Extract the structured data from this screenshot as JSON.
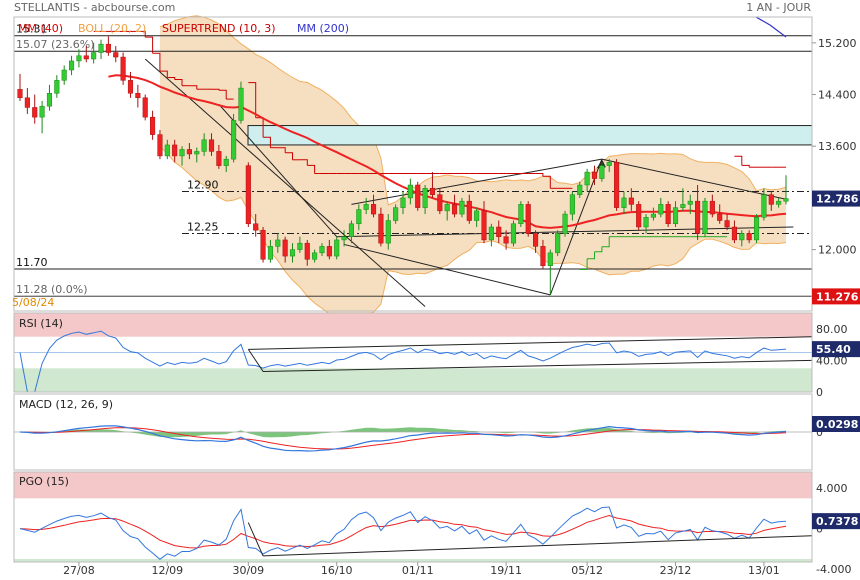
{
  "header": {
    "title": "STELLANTIS - abcbourse.com",
    "period": "1 AN - JOUR"
  },
  "colors": {
    "up": "#33cc33",
    "down": "#ee2222",
    "mm40": "#ee2222",
    "mm200": "#3333cc",
    "boll_fill": "#f5d9b5",
    "boll_line": "#f0b060",
    "supertrend": "#cc0000",
    "supertrend_up": "#22aa22",
    "zone_fill": "#cfeeee",
    "overbought": "#f4c8c8",
    "oversold": "#cfe8cf",
    "rsi": "#3377dd",
    "macd": "#3377dd",
    "signal": "#ee2222",
    "hist": "#66bb66",
    "pgo": "#3377dd",
    "pgo_signal": "#ee2222",
    "badge": "#1e2a6a",
    "badge_red": "#dd1111"
  },
  "legend_price": [
    {
      "label": "MM (40)",
      "color": "#dd0000"
    },
    {
      "label": "BOLL (20, 2)",
      "color": "#f0a040"
    },
    {
      "label": "SUPERTREND (10, 3)",
      "color": "#cc0000"
    },
    {
      "label": "MM (200)",
      "color": "#3333cc"
    }
  ],
  "legend_rsi": "RSI (14)",
  "legend_macd": "MACD (12, 26, 9)",
  "legend_pgo": "PGO (15)",
  "price_levels": [
    {
      "price": 15.31,
      "label": "15.31"
    },
    {
      "price": 15.07,
      "label": "15.07  (23.6%)"
    },
    {
      "price": 11.7,
      "label": "11.70"
    },
    {
      "price": 11.28,
      "label": "11.28  (0.0%)"
    }
  ],
  "dash_levels": [
    {
      "price": 12.9,
      "label": "12.90"
    },
    {
      "price": 12.25,
      "label": "12.25"
    }
  ],
  "zone": {
    "from": 13.62,
    "to": 13.92
  },
  "date_marker": "5/08/24",
  "badges": {
    "last": "12.786",
    "low": "11.276",
    "rsi": "55.40",
    "macd": "0.0298",
    "pgo": "0.7378"
  },
  "chart_data": {
    "type": "candlestick",
    "x_ticks": [
      "27/08",
      "12/09",
      "30/09",
      "16/10",
      "01/11",
      "19/11",
      "05/12",
      "23/12",
      "13/01"
    ],
    "price_axis": {
      "ylim": [
        11.05,
        15.6
      ],
      "ticks": [
        "15.200",
        "14.400",
        "13.600",
        "12.800",
        "12.000"
      ]
    },
    "candles": [
      [
        14.48,
        14.72,
        14.3,
        14.35
      ],
      [
        14.35,
        14.5,
        14.1,
        14.2
      ],
      [
        14.2,
        14.4,
        13.95,
        14.05
      ],
      [
        14.05,
        14.3,
        13.8,
        14.22
      ],
      [
        14.22,
        14.55,
        14.15,
        14.42
      ],
      [
        14.42,
        14.7,
        14.35,
        14.62
      ],
      [
        14.62,
        14.85,
        14.55,
        14.78
      ],
      [
        14.78,
        15.0,
        14.7,
        14.92
      ],
      [
        14.92,
        15.1,
        14.82,
        15.0
      ],
      [
        15.0,
        15.15,
        14.9,
        14.95
      ],
      [
        14.95,
        15.2,
        14.88,
        15.05
      ],
      [
        15.05,
        15.25,
        14.95,
        15.18
      ],
      [
        15.18,
        15.3,
        15.0,
        15.05
      ],
      [
        15.05,
        15.15,
        14.9,
        14.98
      ],
      [
        14.98,
        15.05,
        14.55,
        14.62
      ],
      [
        14.62,
        14.75,
        14.35,
        14.42
      ],
      [
        14.42,
        14.55,
        14.2,
        14.35
      ],
      [
        14.35,
        14.4,
        14.0,
        14.05
      ],
      [
        14.05,
        14.15,
        13.7,
        13.78
      ],
      [
        13.78,
        13.85,
        13.4,
        13.45
      ],
      [
        13.45,
        13.7,
        13.4,
        13.62
      ],
      [
        13.62,
        13.7,
        13.35,
        13.45
      ],
      [
        13.45,
        13.6,
        13.3,
        13.55
      ],
      [
        13.55,
        13.65,
        13.4,
        13.48
      ],
      [
        13.48,
        13.58,
        13.35,
        13.52
      ],
      [
        13.52,
        13.8,
        13.45,
        13.7
      ],
      [
        13.7,
        13.8,
        13.45,
        13.52
      ],
      [
        13.52,
        13.62,
        13.25,
        13.3
      ],
      [
        13.3,
        13.45,
        13.2,
        13.4
      ],
      [
        13.4,
        14.1,
        13.35,
        14.0
      ],
      [
        14.0,
        14.6,
        13.95,
        14.5
      ],
      [
        13.3,
        13.35,
        12.35,
        12.4
      ],
      [
        12.4,
        12.55,
        12.2,
        12.3
      ],
      [
        12.3,
        12.35,
        11.8,
        11.85
      ],
      [
        11.85,
        12.15,
        11.8,
        12.05
      ],
      [
        12.05,
        12.25,
        11.95,
        12.15
      ],
      [
        12.15,
        12.2,
        11.8,
        11.9
      ],
      [
        11.9,
        12.1,
        11.8,
        12.0
      ],
      [
        12.0,
        12.2,
        11.95,
        12.1
      ],
      [
        12.1,
        12.15,
        11.75,
        11.85
      ],
      [
        11.85,
        12.0,
        11.8,
        11.95
      ],
      [
        11.95,
        12.1,
        11.9,
        12.05
      ],
      [
        12.05,
        12.15,
        11.85,
        11.9
      ],
      [
        11.9,
        12.2,
        11.85,
        12.15
      ],
      [
        12.15,
        12.3,
        12.05,
        12.2
      ],
      [
        12.2,
        12.45,
        12.1,
        12.4
      ],
      [
        12.4,
        12.7,
        12.3,
        12.62
      ],
      [
        12.62,
        12.8,
        12.55,
        12.7
      ],
      [
        12.7,
        12.85,
        12.5,
        12.55
      ],
      [
        12.55,
        12.65,
        12.05,
        12.1
      ],
      [
        12.1,
        12.55,
        12.0,
        12.45
      ],
      [
        12.45,
        12.7,
        12.4,
        12.65
      ],
      [
        12.65,
        12.9,
        12.55,
        12.8
      ],
      [
        12.8,
        13.1,
        12.7,
        13.0
      ],
      [
        13.0,
        13.05,
        12.6,
        12.65
      ],
      [
        12.65,
        13.0,
        12.55,
        12.95
      ],
      [
        12.95,
        13.2,
        12.8,
        12.85
      ],
      [
        12.85,
        12.95,
        12.55,
        12.6
      ],
      [
        12.6,
        12.75,
        12.45,
        12.7
      ],
      [
        12.7,
        12.85,
        12.5,
        12.55
      ],
      [
        12.55,
        12.8,
        12.5,
        12.75
      ],
      [
        12.75,
        12.85,
        12.4,
        12.45
      ],
      [
        12.45,
        12.65,
        12.35,
        12.6
      ],
      [
        12.6,
        12.75,
        12.1,
        12.15
      ],
      [
        12.15,
        12.4,
        12.05,
        12.35
      ],
      [
        12.35,
        12.45,
        12.1,
        12.2
      ],
      [
        12.2,
        12.3,
        12.0,
        12.1
      ],
      [
        12.1,
        12.45,
        12.05,
        12.4
      ],
      [
        12.4,
        12.75,
        12.35,
        12.7
      ],
      [
        12.7,
        12.75,
        12.2,
        12.25
      ],
      [
        12.25,
        12.3,
        11.95,
        12.05
      ],
      [
        12.05,
        12.15,
        11.7,
        11.75
      ],
      [
        11.75,
        12.0,
        11.3,
        11.95
      ],
      [
        11.95,
        12.3,
        11.9,
        12.25
      ],
      [
        12.25,
        12.6,
        12.2,
        12.55
      ],
      [
        12.55,
        12.9,
        12.45,
        12.85
      ],
      [
        12.85,
        13.05,
        12.8,
        13.0
      ],
      [
        13.0,
        13.25,
        12.9,
        13.2
      ],
      [
        13.2,
        13.3,
        13.0,
        13.1
      ],
      [
        13.1,
        13.35,
        13.05,
        13.3
      ],
      [
        13.3,
        13.4,
        13.2,
        13.35
      ],
      [
        13.35,
        13.4,
        12.6,
        12.65
      ],
      [
        12.65,
        12.9,
        12.55,
        12.8
      ],
      [
        12.8,
        12.95,
        12.6,
        12.7
      ],
      [
        12.7,
        12.75,
        12.3,
        12.35
      ],
      [
        12.35,
        12.55,
        12.25,
        12.5
      ],
      [
        12.5,
        12.65,
        12.45,
        12.55
      ],
      [
        12.55,
        12.8,
        12.5,
        12.7
      ],
      [
        12.7,
        12.75,
        12.35,
        12.4
      ],
      [
        12.4,
        12.75,
        12.35,
        12.65
      ],
      [
        12.65,
        12.95,
        12.6,
        12.7
      ],
      [
        12.7,
        12.85,
        12.55,
        12.75
      ],
      [
        12.75,
        13.0,
        12.15,
        12.25
      ],
      [
        12.25,
        12.8,
        12.2,
        12.75
      ],
      [
        12.75,
        12.85,
        12.5,
        12.55
      ],
      [
        12.55,
        12.7,
        12.4,
        12.45
      ],
      [
        12.45,
        12.55,
        12.3,
        12.35
      ],
      [
        12.35,
        12.45,
        12.1,
        12.15
      ],
      [
        12.15,
        12.3,
        12.05,
        12.25
      ],
      [
        12.25,
        12.3,
        12.1,
        12.15
      ],
      [
        12.15,
        12.55,
        12.1,
        12.5
      ],
      [
        12.5,
        12.95,
        12.45,
        12.85
      ],
      [
        12.85,
        12.9,
        12.6,
        12.7
      ],
      [
        12.7,
        12.8,
        12.65,
        12.75
      ],
      [
        12.75,
        13.15,
        12.7,
        12.79
      ]
    ],
    "rsi": {
      "ylim": [
        0,
        100
      ],
      "ticks": [
        "80.00",
        "40.00",
        "0"
      ],
      "overbought": 70,
      "oversold": 30
    },
    "macd": {
      "ylim": [
        -1.2,
        1.2
      ],
      "ticks": [
        "0"
      ]
    },
    "pgo": {
      "ylim": [
        -3.3,
        5.6
      ],
      "ticks": [
        "4.000",
        "0",
        "-4.000"
      ],
      "overbought": 3.0,
      "oversold": -3.0
    }
  }
}
